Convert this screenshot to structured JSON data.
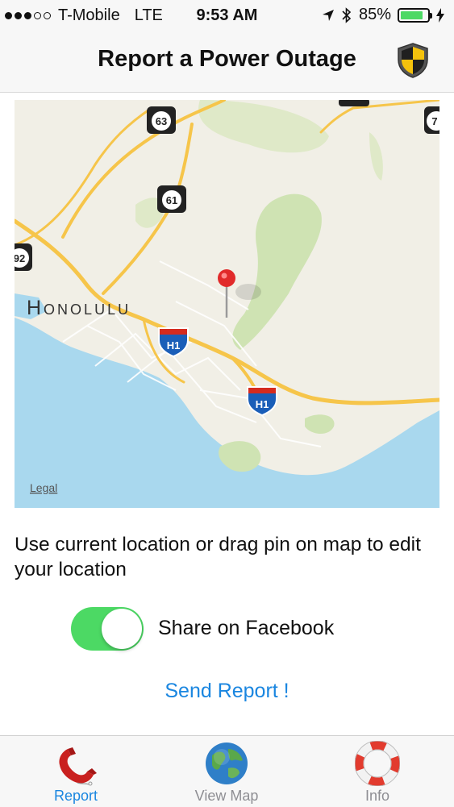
{
  "status_bar": {
    "carrier": "T-Mobile",
    "network": "LTE",
    "time": "9:53 AM",
    "battery_text": "85%",
    "battery_level": 0.85,
    "signal_bars": 3,
    "signal_total": 5
  },
  "nav": {
    "title": "Report a Power Outage"
  },
  "map": {
    "city_label": "Honolulu",
    "legal_label": "Legal",
    "route_shields": [
      "63",
      "61",
      "92",
      "7"
    ],
    "interstate_shields": [
      "H1",
      "H1"
    ]
  },
  "instructions": "Use current location or drag pin on map to edit your location",
  "facebook": {
    "label": "Share on Facebook",
    "enabled": true
  },
  "send_label": "Send Report !",
  "tabs": [
    {
      "label": "Report",
      "icon": "phone-icon",
      "active": true
    },
    {
      "label": "View Map",
      "icon": "globe-icon",
      "active": false
    },
    {
      "label": "Info",
      "icon": "lifebuoy-icon",
      "active": false
    }
  ],
  "colors": {
    "accent": "#1a86e0",
    "toggle_on": "#4cd964",
    "water": "#a9d8ee",
    "land": "#f1efe6",
    "park": "#cfe3b3",
    "road": "#f6c54a"
  }
}
